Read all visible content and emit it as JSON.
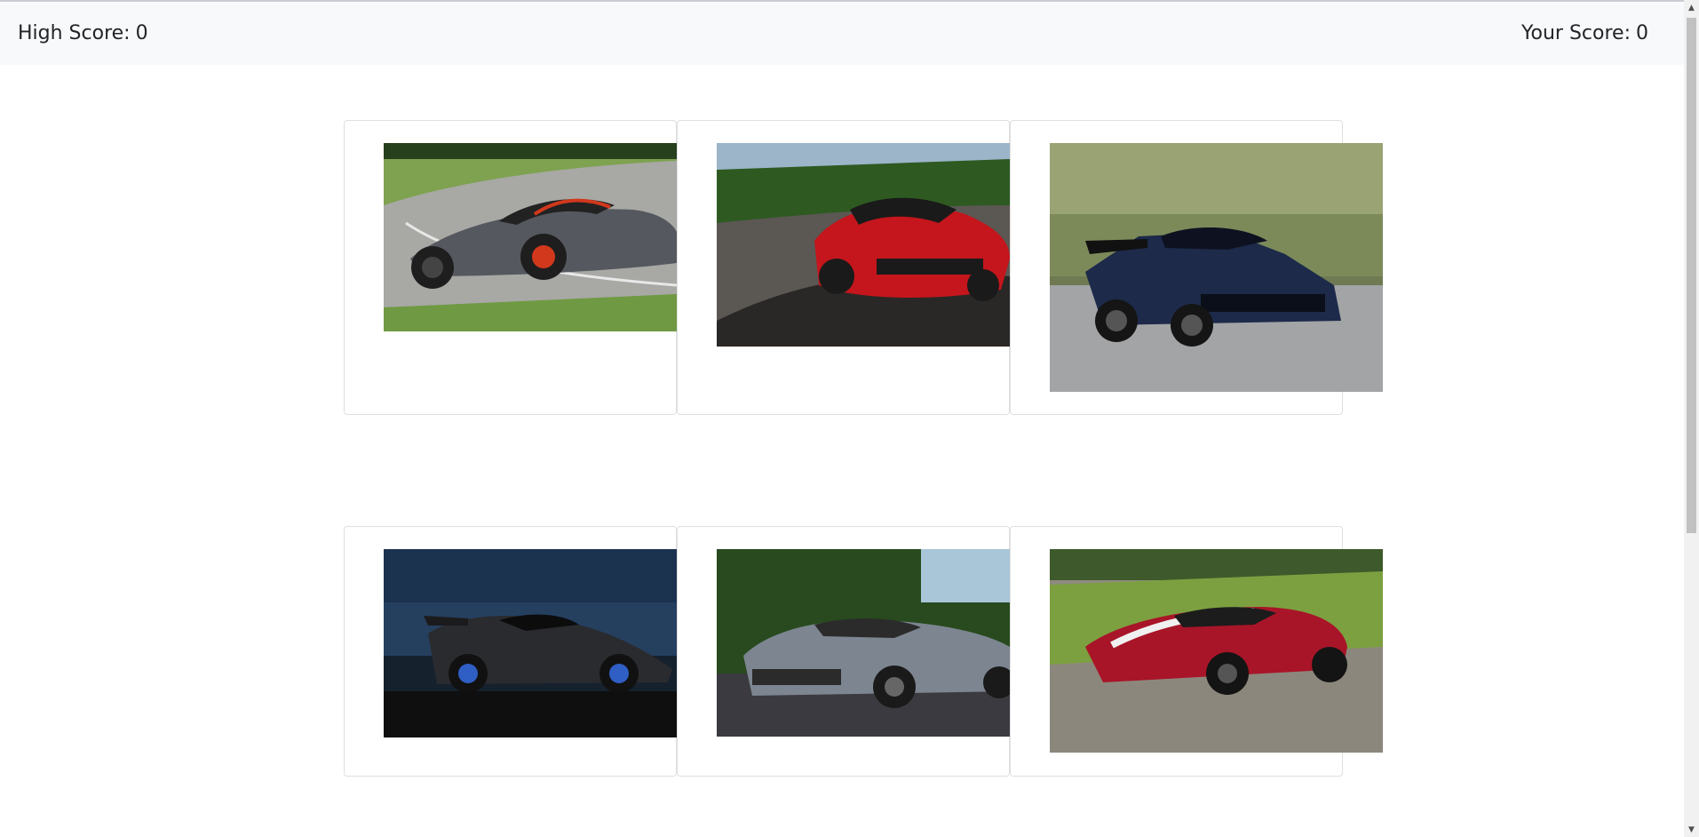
{
  "header": {
    "high_score_label": "High Score:",
    "high_score_value": "0",
    "your_score_label": "Your Score:",
    "your_score_value": "0"
  },
  "cards": [
    {
      "car": "gray-ford-gt-on-track",
      "body_color": "#5a5d62",
      "accent": "#d2381c"
    },
    {
      "car": "red-corvette-zr1-on-track",
      "body_color": "#c4161c",
      "accent": "#1a1a1a"
    },
    {
      "car": "blue-viper-acr-on-track",
      "body_color": "#1d2a4a",
      "accent": "#b7b9bf"
    },
    {
      "car": "black-corvette-zr1-studio",
      "body_color": "#2a2b2e",
      "accent": "#2f5ec4"
    },
    {
      "car": "silver-ford-gt-parked",
      "body_color": "#7d8591",
      "accent": "#2b2b2b"
    },
    {
      "car": "red-ford-gt-stripes-on-track",
      "body_color": "#a81528",
      "accent": "#f0f0f0"
    }
  ]
}
